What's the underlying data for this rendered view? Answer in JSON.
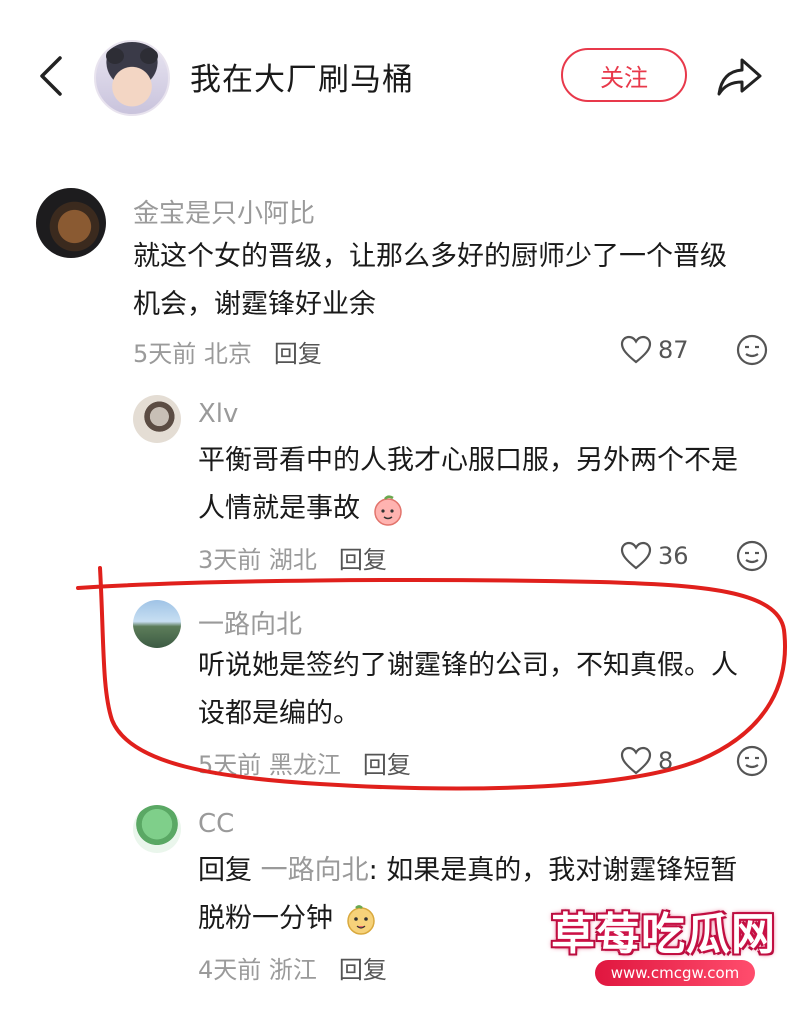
{
  "header": {
    "title": "我在大厂刷马桶",
    "follow_label": "关注"
  },
  "comments": [
    {
      "username": "金宝是只小阿比",
      "text_lines": [
        "就这个女的晋级，让那么多好的厨师少了一个晋级",
        "机会，谢霆锋好业余"
      ],
      "time_location": "5天前 北京",
      "reply_label": "回复",
      "likes": "87"
    },
    {
      "username": "Xlv",
      "text_lines": [
        "平衡哥看中的人我才心服口服，另外两个不是",
        "人情就是事故"
      ],
      "time_location": "3天前 湖北",
      "reply_label": "回复",
      "likes": "36"
    },
    {
      "username": "一路向北",
      "text_lines": [
        "听说她是签约了谢霆锋的公司，不知真假。人",
        "设都是编的。"
      ],
      "time_location": "5天前 黑龙江",
      "reply_label": "回复",
      "likes": "8"
    },
    {
      "username": "CC",
      "reply_prefix": "回复",
      "reply_target": "一路向北",
      "text_line1_rest": ": 如果是真的，我对谢霆锋短暂",
      "text_line2": "脱粉一分钟",
      "time_location": "4天前 浙江",
      "reply_label": "回复"
    }
  ],
  "watermark": {
    "title": "草莓吃瓜网",
    "url": "www.cmcgw.com"
  },
  "colors": {
    "accent": "#e8394b",
    "muted_text": "#9a9a9a",
    "annotation": "#e0201c"
  }
}
